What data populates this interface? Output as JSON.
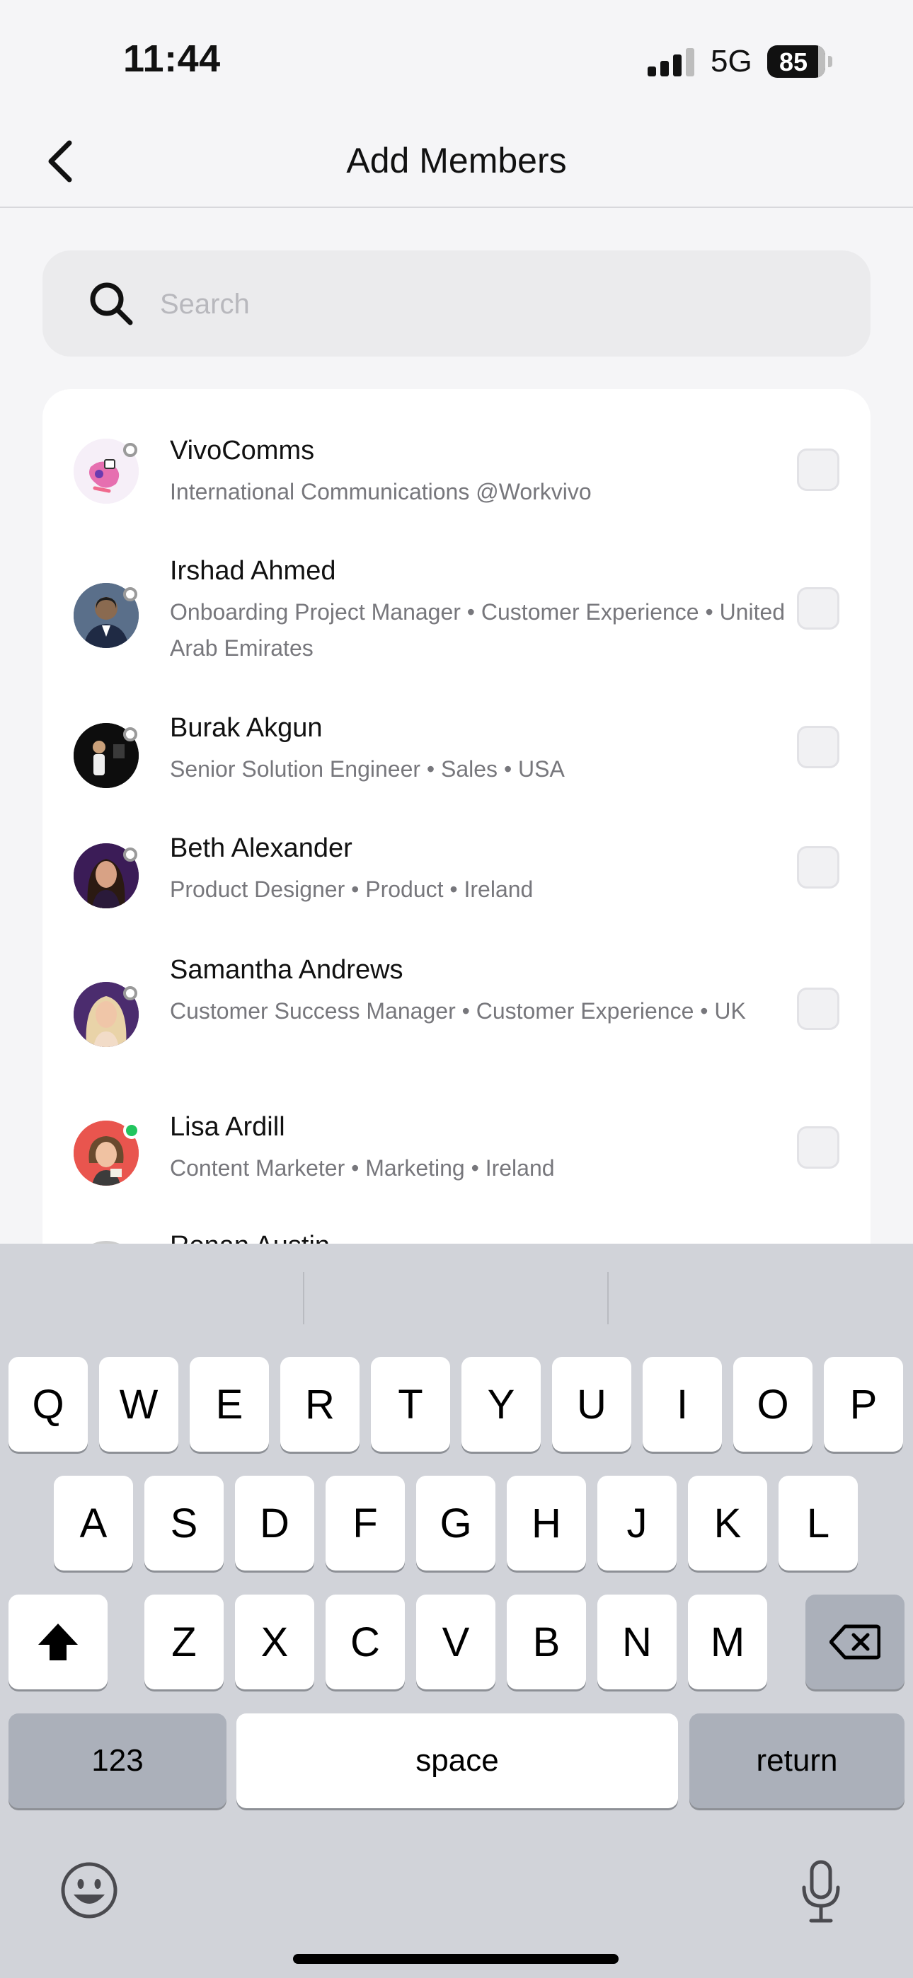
{
  "status": {
    "time": "11:44",
    "network": "5G",
    "battery": "85"
  },
  "nav": {
    "title": "Add Members"
  },
  "search": {
    "placeholder": "Search"
  },
  "members": [
    {
      "name": "VivoComms",
      "subtitle": "International Communications @Workvivo",
      "online": false,
      "avatar_color": "#f3e8f5"
    },
    {
      "name": "Irshad Ahmed",
      "subtitle": "Onboarding Project Manager • Customer Experience • United Arab Emirates",
      "online": false,
      "avatar_color": "#3b4d6b"
    },
    {
      "name": "Burak Akgun",
      "subtitle": "Senior Solution Engineer • Sales • USA",
      "online": false,
      "avatar_color": "#111111"
    },
    {
      "name": "Beth Alexander",
      "subtitle": "Product Designer • Product • Ireland",
      "online": false,
      "avatar_color": "#3a1f4f"
    },
    {
      "name": "Samantha Andrews",
      "subtitle": "Customer Success Manager • Customer Experience • UK",
      "online": false,
      "avatar_color": "#4a2d6a"
    },
    {
      "name": "Lisa Ardill",
      "subtitle": "Content Marketer • Marketing • Ireland",
      "online": true,
      "avatar_color": "#e8574f"
    },
    {
      "name": "Ronan Austin",
      "subtitle": "",
      "online": false,
      "avatar_color": "#cccccc"
    }
  ],
  "keyboard": {
    "row1": [
      "Q",
      "W",
      "E",
      "R",
      "T",
      "Y",
      "U",
      "I",
      "O",
      "P"
    ],
    "row2": [
      "A",
      "S",
      "D",
      "F",
      "G",
      "H",
      "J",
      "K",
      "L"
    ],
    "row3": [
      "Z",
      "X",
      "C",
      "V",
      "B",
      "N",
      "M"
    ],
    "numbers_label": "123",
    "space_label": "space",
    "return_label": "return"
  },
  "icons": [
    "chevron-left-icon",
    "search-icon",
    "shift-icon",
    "backspace-icon",
    "emoji-icon",
    "microphone-icon"
  ]
}
